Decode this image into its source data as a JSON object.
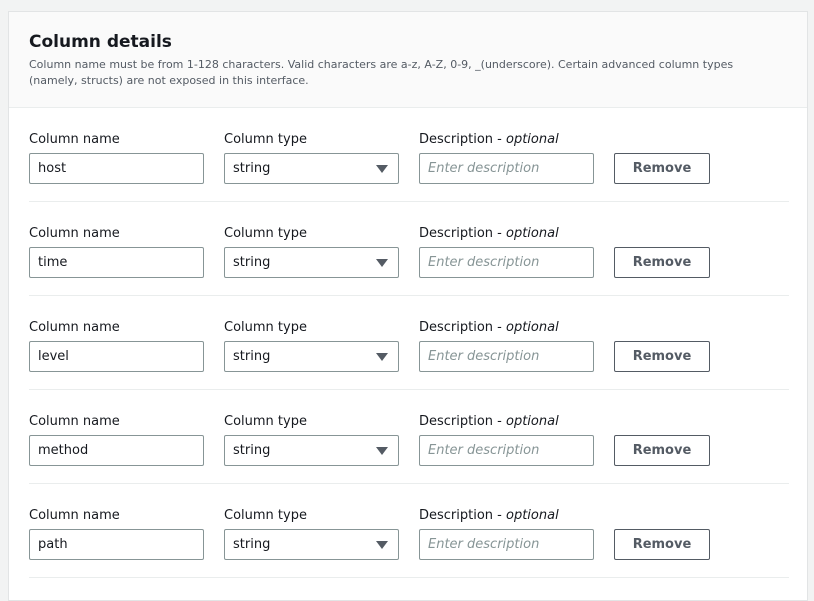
{
  "section": {
    "title": "Column details",
    "description": "Column name must be from 1-128 characters. Valid characters are a-z, A-Z, 0-9, _(underscore). Certain advanced column types (namely, structs) are not exposed in this interface."
  },
  "labels": {
    "column_name": "Column name",
    "column_type": "Column type",
    "description": "Description - ",
    "optional": "optional",
    "description_placeholder": "Enter description",
    "remove": "Remove"
  },
  "columns": [
    {
      "name": "host",
      "type": "string",
      "description": ""
    },
    {
      "name": "time",
      "type": "string",
      "description": ""
    },
    {
      "name": "level",
      "type": "string",
      "description": ""
    },
    {
      "name": "method",
      "type": "string",
      "description": ""
    },
    {
      "name": "path",
      "type": "string",
      "description": ""
    }
  ],
  "colors": {
    "border": "#879596",
    "button_text": "#545b64",
    "header_bg": "#fafafa"
  },
  "icons": {
    "type_dropdown": "caret-down-icon"
  }
}
